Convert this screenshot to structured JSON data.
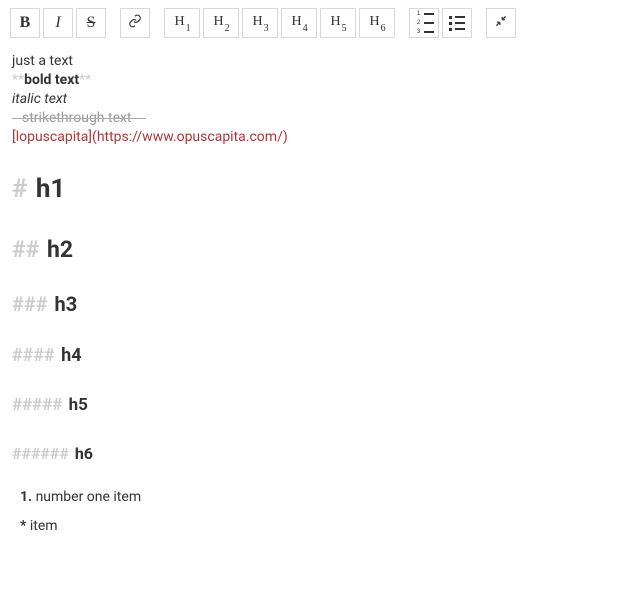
{
  "toolbar": {
    "bold_label": "B",
    "italic_label": "I",
    "strike_label": "S",
    "h1": "H",
    "h1n": "1",
    "h2": "H",
    "h2n": "2",
    "h3": "H",
    "h3n": "3",
    "h4": "H",
    "h4n": "4",
    "h5": "H",
    "h5n": "5",
    "h6": "H",
    "h6n": "6"
  },
  "content": {
    "line1": "just a text",
    "bold_marker_pre": "**",
    "bold_text": "bold text",
    "bold_marker_post": "**",
    "italic_text": "italic text",
    "strike_text": "strikethrough text",
    "link_line": "[lopuscapita](https://www.opuscapita.com/)",
    "h1_hash": "#",
    "h1_text": " h1",
    "h2_hash": "##",
    "h2_text": " h2",
    "h3_hash": "###",
    "h3_text": " h3",
    "h4_hash": "####",
    "h4_text": " h4",
    "h5_hash": "#####",
    "h5_text": " h5",
    "h6_hash": "######",
    "h6_text": " h6",
    "ol_num": "1.",
    "ol_item": " number one item",
    "ul_star": "*",
    "ul_item": " item"
  }
}
